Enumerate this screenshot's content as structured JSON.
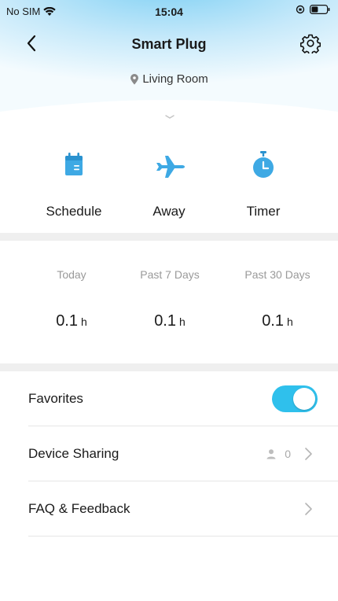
{
  "status_bar": {
    "carrier": "No SIM",
    "time": "15:04"
  },
  "nav": {
    "title": "Smart Plug",
    "back_icon": "chevron-left-icon",
    "settings_icon": "gear-icon"
  },
  "location": {
    "label": "Living Room",
    "icon": "location-pin-icon"
  },
  "modes": [
    {
      "label": "Schedule",
      "icon": "calendar-icon"
    },
    {
      "label": "Away",
      "icon": "airplane-icon"
    },
    {
      "label": "Timer",
      "icon": "stopwatch-icon"
    }
  ],
  "usage": [
    {
      "period": "Today",
      "value": "0.1",
      "unit": "h"
    },
    {
      "period": "Past 7 Days",
      "value": "0.1",
      "unit": "h"
    },
    {
      "period": "Past 30 Days",
      "value": "0.1",
      "unit": "h"
    }
  ],
  "settings": {
    "favorites": {
      "label": "Favorites",
      "enabled": true
    },
    "device_sharing": {
      "label": "Device Sharing",
      "count": "0"
    },
    "faq": {
      "label": "FAQ & Feedback"
    }
  },
  "colors": {
    "accent": "#2fc0ec",
    "header_gradient_top": "#7fd0f4",
    "icon_blue": "#3ea9e4"
  }
}
